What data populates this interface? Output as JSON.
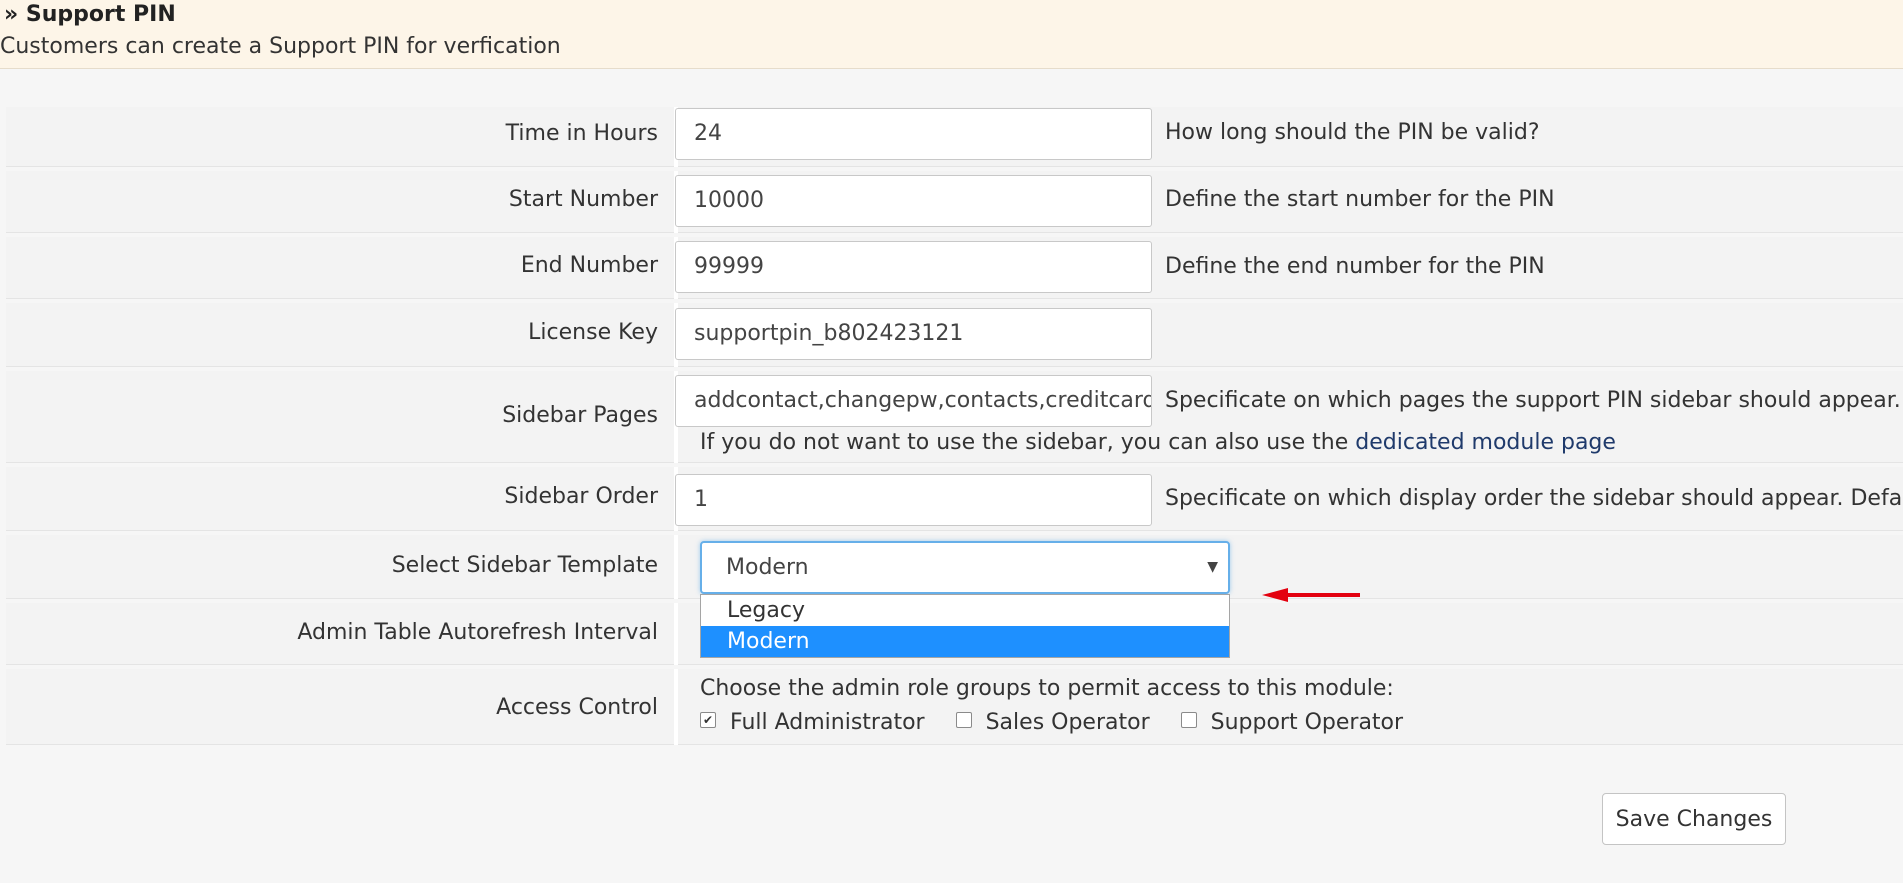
{
  "header": {
    "title": "» Support PIN",
    "description": "Customers can create a Support PIN for verfication"
  },
  "form": {
    "time_in_hours": {
      "label": "Time in Hours",
      "value": "24",
      "help": "How long should the PIN be valid?"
    },
    "start_number": {
      "label": "Start Number",
      "value": "10000",
      "help": "Define the start number for the PIN"
    },
    "end_number": {
      "label": "End Number",
      "value": "99999",
      "help": "Define the end number for the PIN"
    },
    "license_key": {
      "label": "License Key",
      "value": "supportpin_b802423121"
    },
    "sidebar_pages": {
      "label": "Sidebar Pages",
      "value": "addcontact,changepw,contacts,creditcard,",
      "help": "Specificate on which pages the support PIN sidebar should appear. Se",
      "note_prefix": "If you do not want to use the sidebar, you can also use the ",
      "note_link": "dedicated module page"
    },
    "sidebar_order": {
      "label": "Sidebar Order",
      "value": "1",
      "help": "Specificate on which display order the sidebar should appear. Defaul"
    },
    "sidebar_template": {
      "label": "Select Sidebar Template",
      "selected": "Modern",
      "options": [
        "Legacy",
        "Modern"
      ]
    },
    "autorefresh": {
      "label": "Admin Table Autorefresh Interval"
    },
    "access_control": {
      "label": "Access Control",
      "intro": "Choose the admin role groups to permit access to this module:",
      "groups": [
        {
          "name": "Full Administrator",
          "checked": true
        },
        {
          "name": "Sales Operator",
          "checked": false
        },
        {
          "name": "Support Operator",
          "checked": false
        }
      ]
    }
  },
  "actions": {
    "save_label": "Save Changes"
  },
  "colors": {
    "accent": "#1e90ff",
    "annotation_arrow": "#e3000f"
  }
}
